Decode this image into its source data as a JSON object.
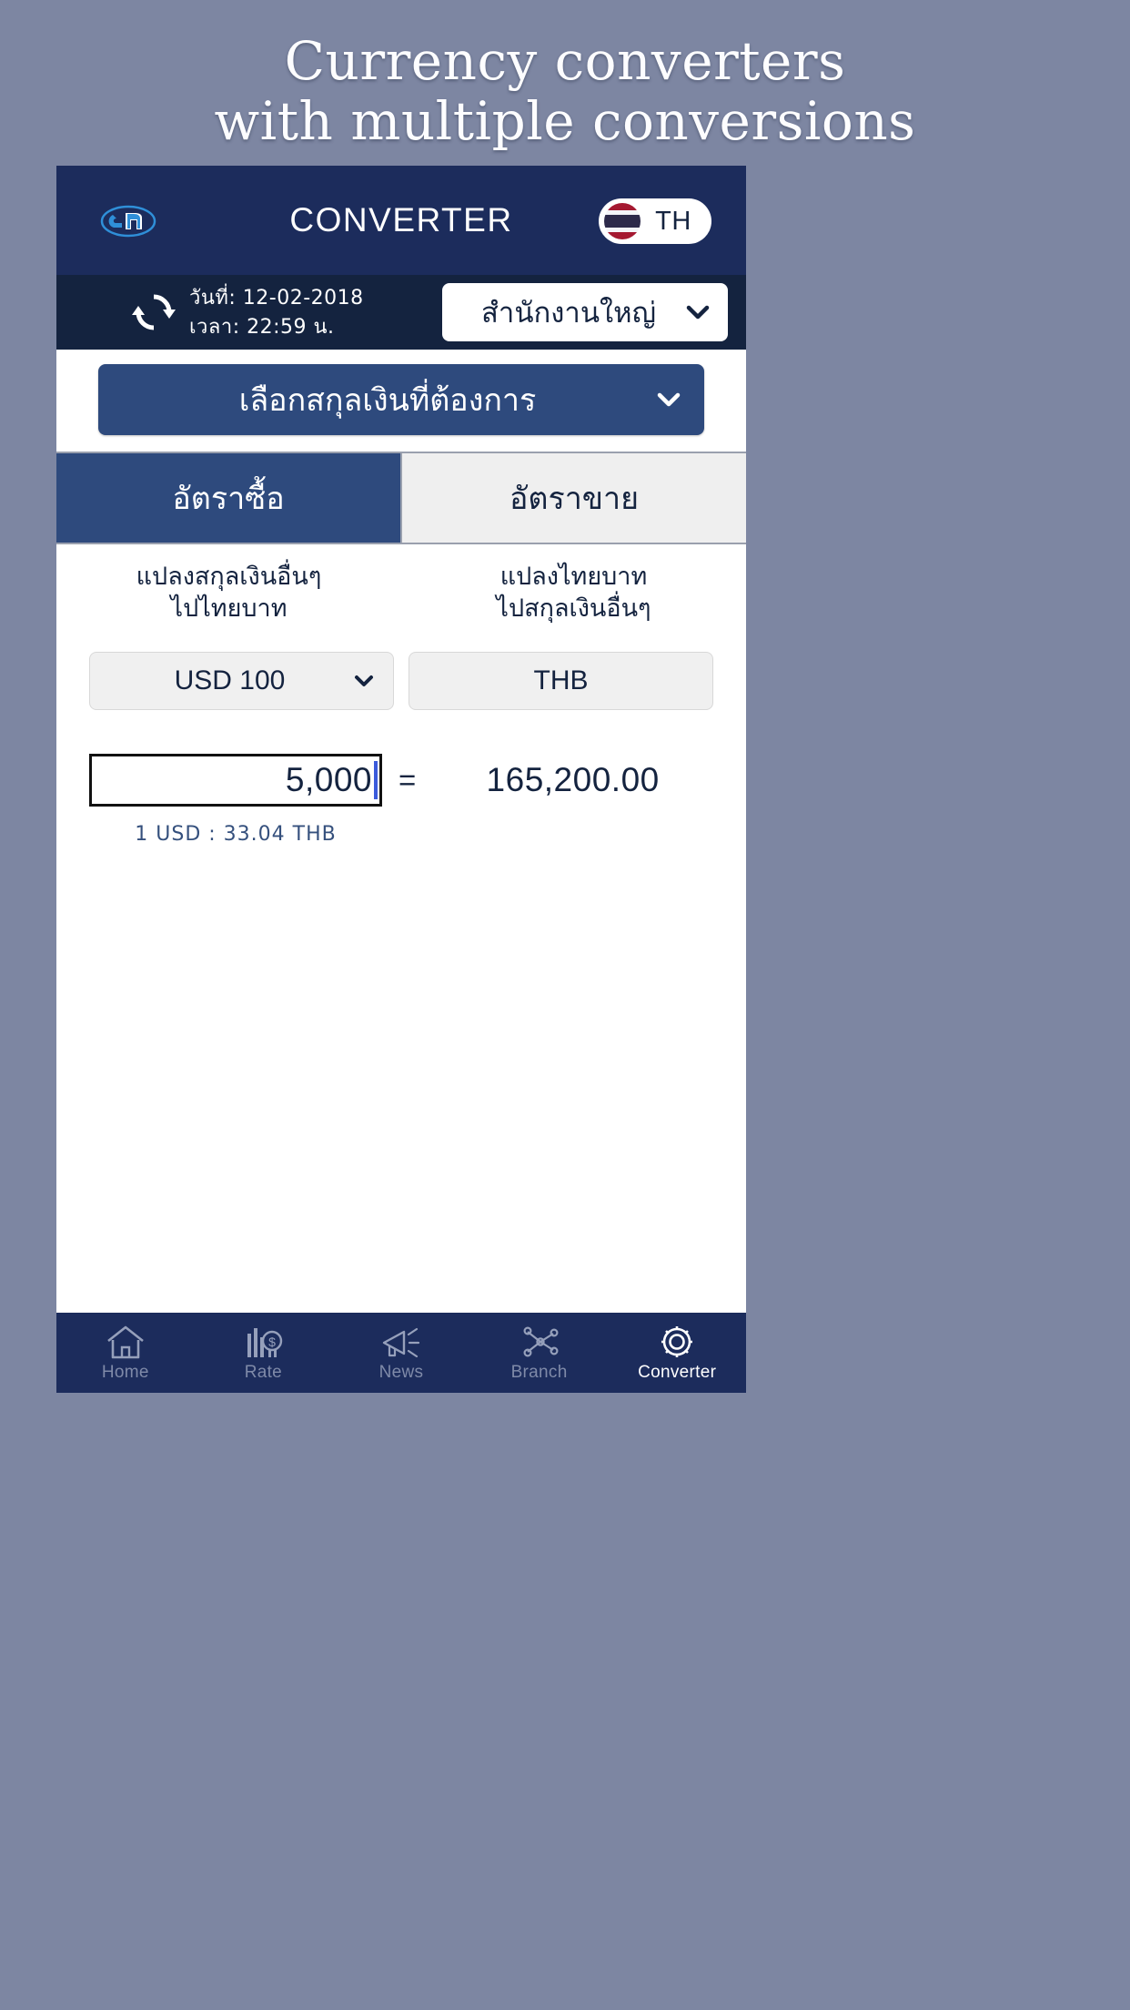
{
  "promo": {
    "line1": "Currency converters",
    "line2": "with multiple conversions"
  },
  "app": {
    "header": {
      "logo_icon": "bank-logo-icon",
      "title": "CONVERTER",
      "language_badge": {
        "flag_icon": "thailand-flag-icon",
        "code": "TH"
      }
    },
    "meta": {
      "refresh_icon": "refresh-icon",
      "date_line": "วันที่: 12-02-2018",
      "time_line": "เวลา: 22:59 น.",
      "office_select": {
        "value": "สำนักงานใหญ่",
        "chevron_icon": "chevron-down-icon"
      }
    },
    "currency_picker": {
      "label": "เลือกสกุลเงินที่ต้องการ",
      "chevron_icon": "chevron-down-icon"
    },
    "tabs": [
      {
        "label": "อัตราซื้อ",
        "active": true
      },
      {
        "label": "อัตราขาย",
        "active": false
      }
    ],
    "columns": {
      "left": {
        "line1": "แปลงสกุลเงินอื่นๆ",
        "line2": "ไปไทยบาท"
      },
      "right": {
        "line1": "แปลงไทยบาท",
        "line2": "ไปสกุลเงินอื่นๆ"
      }
    },
    "selectors": {
      "from": {
        "value": "USD 100",
        "chevron_icon": "chevron-down-icon"
      },
      "to": {
        "value": "THB"
      }
    },
    "conversion": {
      "amount_value": "5,000",
      "equals_sign": "=",
      "result_value": "165,200.00",
      "rate_note": "1 USD : 33.04 THB"
    },
    "bottom_nav": [
      {
        "label": "Home",
        "icon": "home-icon",
        "active": false
      },
      {
        "label": "Rate",
        "icon": "rate-chart-icon",
        "active": false
      },
      {
        "label": "News",
        "icon": "megaphone-icon",
        "active": false
      },
      {
        "label": "Branch",
        "icon": "branch-network-icon",
        "active": false
      },
      {
        "label": "Converter",
        "icon": "gear-icon",
        "active": true
      }
    ]
  },
  "colors": {
    "page_background": "#7d86a2",
    "header_blue": "#1c2c5c",
    "meta_blue": "#14233f",
    "accent_blue": "#2e4a7d",
    "tab_inactive": "#efefef",
    "caret_blue": "#3b5bdb"
  }
}
